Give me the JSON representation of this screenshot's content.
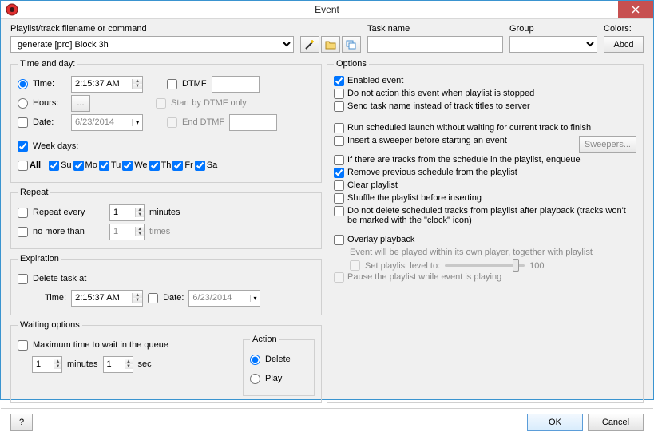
{
  "title": "Event",
  "topbar": {
    "filename_label": "Playlist/track filename or command",
    "filename_value": "generate [pro] Block 3h",
    "taskname_label": "Task name",
    "taskname_value": "",
    "group_label": "Group",
    "group_value": "",
    "colors_label": "Colors:",
    "colors_sample": "Abcd"
  },
  "time": {
    "legend": "Time and day:",
    "time_label": "Time:",
    "time_value": "2:15:37 AM",
    "dtmf_label": "DTMF",
    "dtmf_value": "",
    "hours_label": "Hours:",
    "hours_btn": "...",
    "start_dtmf_label": "Start by DTMF only",
    "date_label": "Date:",
    "date_value": "6/23/2014",
    "end_dtmf_label": "End DTMF",
    "end_dtmf_value": "",
    "weekdays_label": "Week days:",
    "all_label": "All",
    "days": [
      "Su",
      "Mo",
      "Tu",
      "We",
      "Th",
      "Fr",
      "Sa"
    ]
  },
  "repeat": {
    "legend": "Repeat",
    "every_label": "Repeat every",
    "every_value": "1",
    "minutes_label": "minutes",
    "nomore_label": "no more than",
    "nomore_value": "1",
    "times_label": "times"
  },
  "expiration": {
    "legend": "Expiration",
    "delete_label": "Delete task at",
    "time_label": "Time:",
    "time_value": "2:15:37 AM",
    "date_label": "Date:",
    "date_value": "6/23/2014"
  },
  "waiting": {
    "legend": "Waiting options",
    "max_label": "Maximum time to wait in the queue",
    "min_value": "1",
    "minutes_label": "minutes",
    "sec_value": "1",
    "sec_label": "sec",
    "action_legend": "Action",
    "delete_label": "Delete",
    "play_label": "Play"
  },
  "options": {
    "legend": "Options",
    "enabled": "Enabled event",
    "no_action": "Do not action this event when playlist is stopped",
    "send_task": "Send task name instead of track titles to server",
    "run_sched": "Run scheduled launch without waiting for current track to finish",
    "insert_sweeper": "Insert a sweeper before starting an event",
    "sweepers_btn": "Sweepers...",
    "if_tracks": "If there are tracks from the schedule in the playlist, enqueue",
    "remove_prev": "Remove previous schedule from the playlist",
    "clear_playlist": "Clear playlist",
    "shuffle": "Shuffle the playlist before inserting",
    "no_delete": "Do not delete scheduled tracks from playlist after playback (tracks won't be marked with the \"clock\" icon)",
    "overlay": "Overlay playback",
    "overlay_hint": "Event will be played within its own player, together with playlist",
    "set_level": "Set playlist level to:",
    "level_max": "100",
    "pause": "Pause the playlist while event is playing"
  },
  "footer": {
    "help": "?",
    "ok": "OK",
    "cancel": "Cancel"
  }
}
